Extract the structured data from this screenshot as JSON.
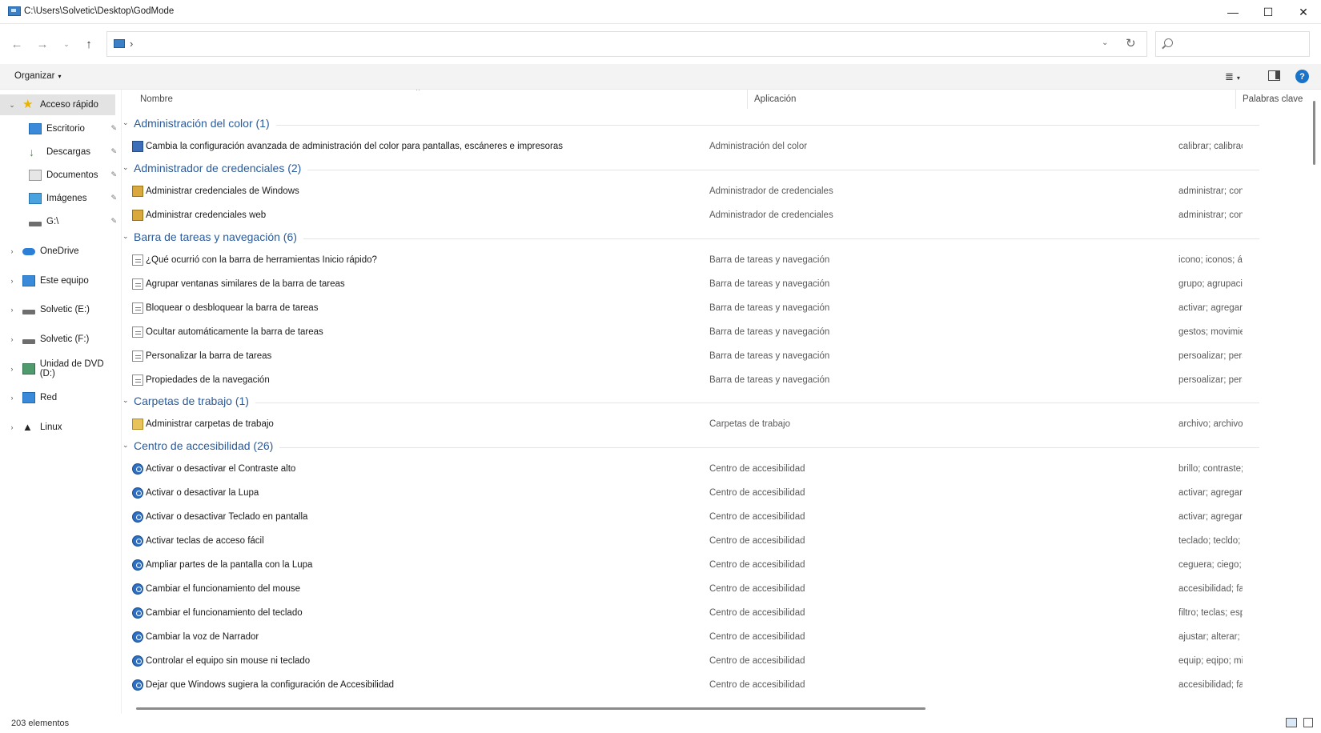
{
  "window": {
    "title": "C:\\Users\\Solvetic\\Desktop\\GodMode",
    "minimize": "—",
    "maximize": "☐",
    "close": "✕"
  },
  "nav": {
    "back": "←",
    "forward": "→",
    "recent": "⌄",
    "up": "↑",
    "address_sep": "›",
    "dropdown": "⌄",
    "refresh": "↻",
    "search_placeholder": ""
  },
  "toolbar": {
    "organize_label": "Organizar",
    "caret": "▾",
    "view_icon": "≣",
    "help_label": "?"
  },
  "sidebar": {
    "items": [
      {
        "label": "Acceso rápido",
        "icon": "star-icon"
      },
      {
        "label": "Escritorio",
        "icon": "desktop-icon"
      },
      {
        "label": "Descargas",
        "icon": "download-icon"
      },
      {
        "label": "Documentos",
        "icon": "document-icon"
      },
      {
        "label": "Imágenes",
        "icon": "pictures-icon"
      },
      {
        "label": "G:\\",
        "icon": "drive-icon"
      },
      {
        "label": "OneDrive",
        "icon": "cloud-icon"
      },
      {
        "label": "Este equipo",
        "icon": "computer-icon"
      },
      {
        "label": "Solvetic (E:)",
        "icon": "drive-icon"
      },
      {
        "label": "Solvetic (F:)",
        "icon": "drive-icon"
      },
      {
        "label": "Unidad de DVD (D:)",
        "icon": "dvd-icon"
      },
      {
        "label": "Red",
        "icon": "network-icon"
      },
      {
        "label": "Linux",
        "icon": "linux-icon"
      }
    ],
    "pin": "📌",
    "chev_open": "⌄",
    "chev_closed": "›"
  },
  "columns": {
    "name": "Nombre",
    "app": "Aplicación",
    "keywords": "Palabras clave",
    "sort_arrow": "^"
  },
  "groups": [
    {
      "title": "Administración del color (1)"
    },
    {
      "title": "Administrador de credenciales (2)"
    },
    {
      "title": "Barra de tareas y navegación (6)"
    },
    {
      "title": "Carpetas de trabajo (1)"
    },
    {
      "title": "Centro de accesibilidad (26)"
    }
  ],
  "rows": [
    {
      "label": "Cambia la configuración avanzada de administración del color para pantallas, escáneres e impresoras",
      "app": "Administración del color",
      "kw": "calibrar; calibrac"
    },
    {
      "label": "Administrar credenciales de Windows",
      "app": "Administrador de credenciales",
      "kw": "administrar; con"
    },
    {
      "label": "Administrar credenciales web",
      "app": "Administrador de credenciales",
      "kw": "administrar; con"
    },
    {
      "label": "¿Qué ocurrió con la barra de herramientas Inicio rápido?",
      "app": "Barra de tareas y navegación",
      "kw": "icono; iconos; ár"
    },
    {
      "label": "Agrupar ventanas similares de la barra de tareas",
      "app": "Barra de tareas y navegación",
      "kw": "grupo; agrupacio"
    },
    {
      "label": "Bloquear o desbloquear la barra de tareas",
      "app": "Barra de tareas y navegación",
      "kw": "activar; agregar;"
    },
    {
      "label": "Ocultar automáticamente la barra de tareas",
      "app": "Barra de tareas y navegación",
      "kw": "gestos; movimie"
    },
    {
      "label": "Personalizar la barra de tareas",
      "app": "Barra de tareas y navegación",
      "kw": "persoalizar; pers"
    },
    {
      "label": "Propiedades de la navegación",
      "app": "Barra de tareas y navegación",
      "kw": "persoalizar; pers"
    },
    {
      "label": "Administrar carpetas de trabajo",
      "app": "Carpetas de trabajo",
      "kw": "archivo; archivos"
    },
    {
      "label": "Activar o desactivar el Contraste alto",
      "app": "Centro de accesibilidad",
      "kw": "brillo; contraste;"
    },
    {
      "label": "Activar o desactivar la Lupa",
      "app": "Centro de accesibilidad",
      "kw": "activar; agregar;"
    },
    {
      "label": "Activar o desactivar Teclado en pantalla",
      "app": "Centro de accesibilidad",
      "kw": "activar; agregar;"
    },
    {
      "label": "Activar teclas de acceso fácil",
      "app": "Centro de accesibilidad",
      "kw": "teclado; tecldo; t"
    },
    {
      "label": "Ampliar partes de la pantalla con la Lupa",
      "app": "Centro de accesibilidad",
      "kw": "ceguera; ciego; r"
    },
    {
      "label": "Cambiar el funcionamiento del mouse",
      "app": "Centro de accesibilidad",
      "kw": "accesibilidad; fac"
    },
    {
      "label": "Cambiar el funcionamiento del teclado",
      "app": "Centro de accesibilidad",
      "kw": "filtro; teclas; esp"
    },
    {
      "label": "Cambiar la voz de Narrador",
      "app": "Centro de accesibilidad",
      "kw": "ajustar; alterar; c"
    },
    {
      "label": "Controlar el equipo sin mouse ni teclado",
      "app": "Centro de accesibilidad",
      "kw": "equip; eqipo; mi"
    },
    {
      "label": "Dejar que Windows sugiera la configuración de Accesibilidad",
      "app": "Centro de accesibilidad",
      "kw": "accesibilidad; fac"
    }
  ],
  "status": {
    "count": "203 elementos"
  }
}
